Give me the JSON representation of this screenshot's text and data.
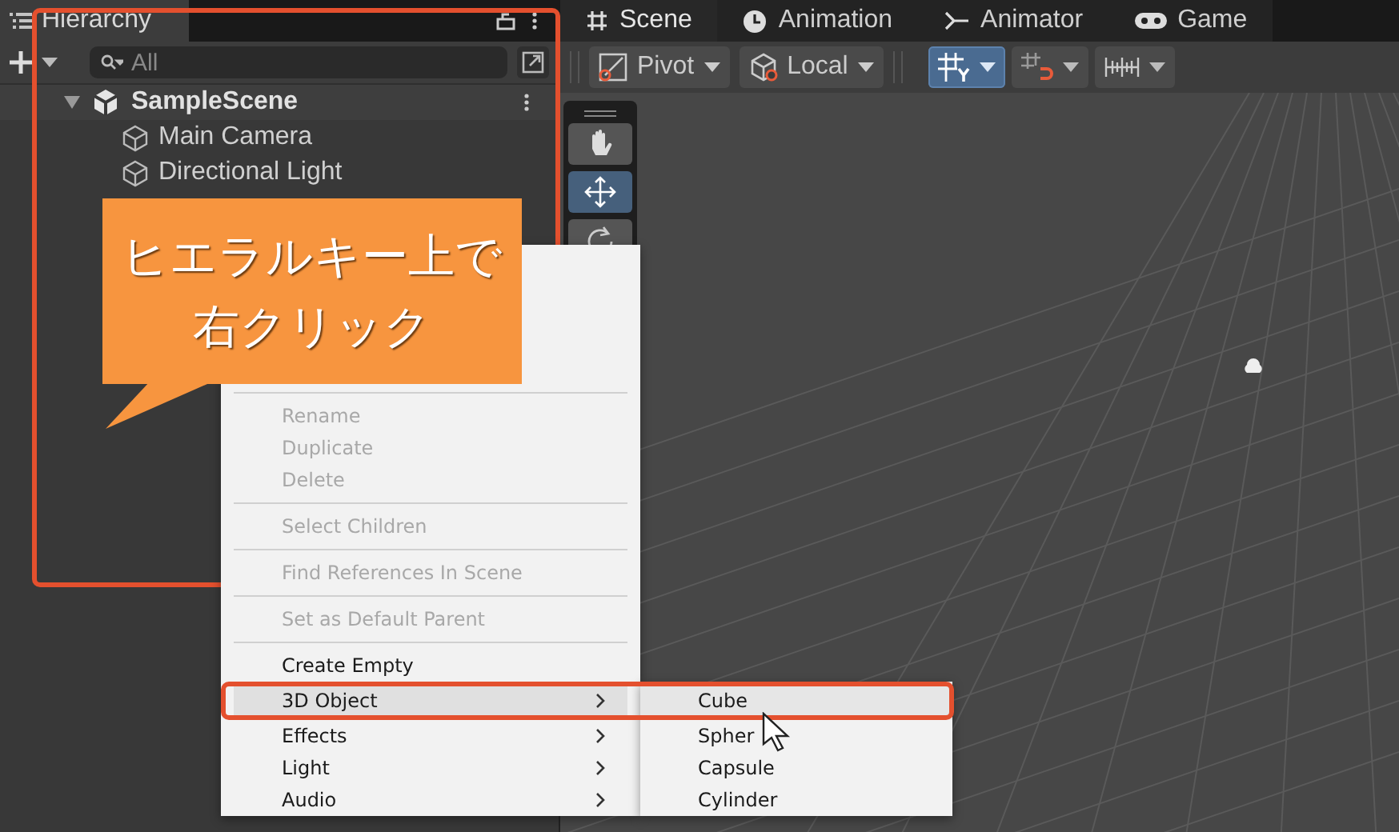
{
  "hierarchy": {
    "tab": {
      "label": "Hierarchy",
      "selected": true
    },
    "search": {
      "placeholder": "All"
    },
    "scene": {
      "name": "SampleScene",
      "expanded": true,
      "children": [
        {
          "label": "Main Camera"
        },
        {
          "label": "Directional Light"
        }
      ]
    }
  },
  "scene_tabs": [
    {
      "label": "Scene",
      "selected": true
    },
    {
      "label": "Animation",
      "selected": false
    },
    {
      "label": "Animator",
      "selected": false
    },
    {
      "label": "Game",
      "selected": false
    }
  ],
  "scene_toolbar": {
    "dropdowns": [
      {
        "label": "Pivot"
      },
      {
        "label": "Local"
      }
    ],
    "toggles": [
      {
        "selected": true
      },
      {
        "selected": false
      },
      {
        "selected": false
      }
    ]
  },
  "tools": [
    {
      "selected": false
    },
    {
      "selected": true
    },
    {
      "selected": false
    }
  ],
  "context_menu": {
    "items": [
      {
        "kind": "separator"
      },
      {
        "kind": "item",
        "label": "Rename",
        "disabled": true,
        "selected": false,
        "submenu": false
      },
      {
        "kind": "item",
        "label": "Duplicate",
        "disabled": true,
        "selected": false,
        "submenu": false
      },
      {
        "kind": "item",
        "label": "Delete",
        "disabled": true,
        "selected": false,
        "submenu": false
      },
      {
        "kind": "separator"
      },
      {
        "kind": "item",
        "label": "Select Children",
        "disabled": true,
        "selected": false,
        "submenu": false
      },
      {
        "kind": "separator"
      },
      {
        "kind": "item",
        "label": "Find References In Scene",
        "disabled": true,
        "selected": false,
        "submenu": false
      },
      {
        "kind": "separator"
      },
      {
        "kind": "item",
        "label": "Set as Default Parent",
        "disabled": true,
        "selected": false,
        "submenu": false
      },
      {
        "kind": "separator"
      },
      {
        "kind": "item",
        "label": "Create Empty",
        "disabled": false,
        "selected": false,
        "submenu": false
      },
      {
        "kind": "item",
        "label": "3D Object",
        "disabled": false,
        "selected": true,
        "submenu": true
      },
      {
        "kind": "item",
        "label": "Effects",
        "disabled": false,
        "selected": false,
        "submenu": true
      },
      {
        "kind": "item",
        "label": "Light",
        "disabled": false,
        "selected": false,
        "submenu": true
      },
      {
        "kind": "item",
        "label": "Audio",
        "disabled": false,
        "selected": false,
        "submenu": true
      }
    ],
    "submenu": [
      {
        "label": "Cube",
        "selected": true
      },
      {
        "label": "Spher",
        "selected": false
      },
      {
        "label": "Capsule",
        "selected": false
      },
      {
        "label": "Cylinder",
        "selected": false
      }
    ]
  },
  "callout": {
    "lines": [
      "ヒエラルキー上で",
      "右クリック"
    ]
  }
}
